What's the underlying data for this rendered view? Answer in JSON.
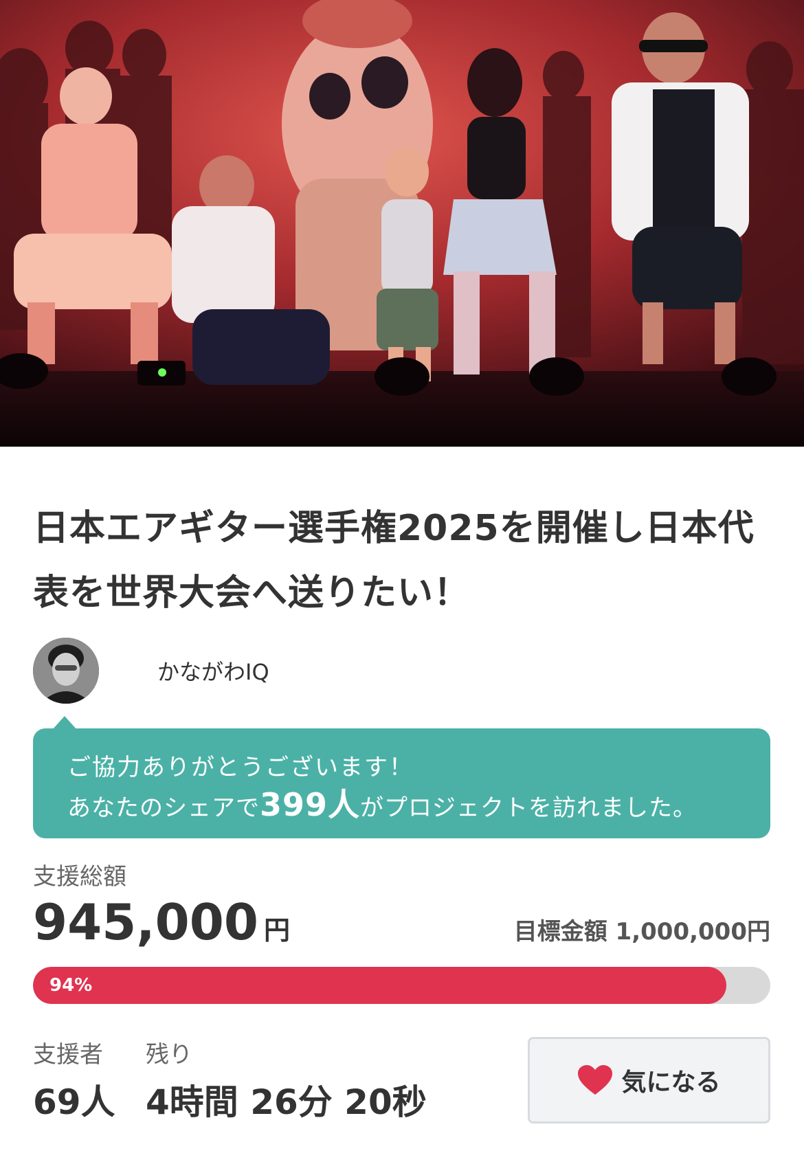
{
  "project": {
    "title": "日本エアギター選手権2025を開催し日本代表を世界大会へ送りたい！",
    "author_name": "かながわIQ"
  },
  "share_message": {
    "line1": "ご協力ありがとうございます！",
    "line2_prefix": "あなたのシェアで",
    "visitor_count": "399人",
    "line2_suffix": "がプロジェクトを訪れました。"
  },
  "funding": {
    "total_label": "支援総額",
    "total_amount": "945,000",
    "currency": "円",
    "goal_text": "目標金額 1,000,000円",
    "progress_percent": 94,
    "progress_label": "94%"
  },
  "stats": {
    "supporters_label": "支援者",
    "supporters_value": "69人",
    "remaining_label": "残り",
    "remaining_value": "4時間 26分 20秒"
  },
  "actions": {
    "favorite_label": "気になる"
  },
  "colors": {
    "accent_teal": "#4bb1a6",
    "progress_red": "#e0334f",
    "heart_red": "#e0334f"
  },
  "icons": {
    "favorite": "heart-icon"
  }
}
